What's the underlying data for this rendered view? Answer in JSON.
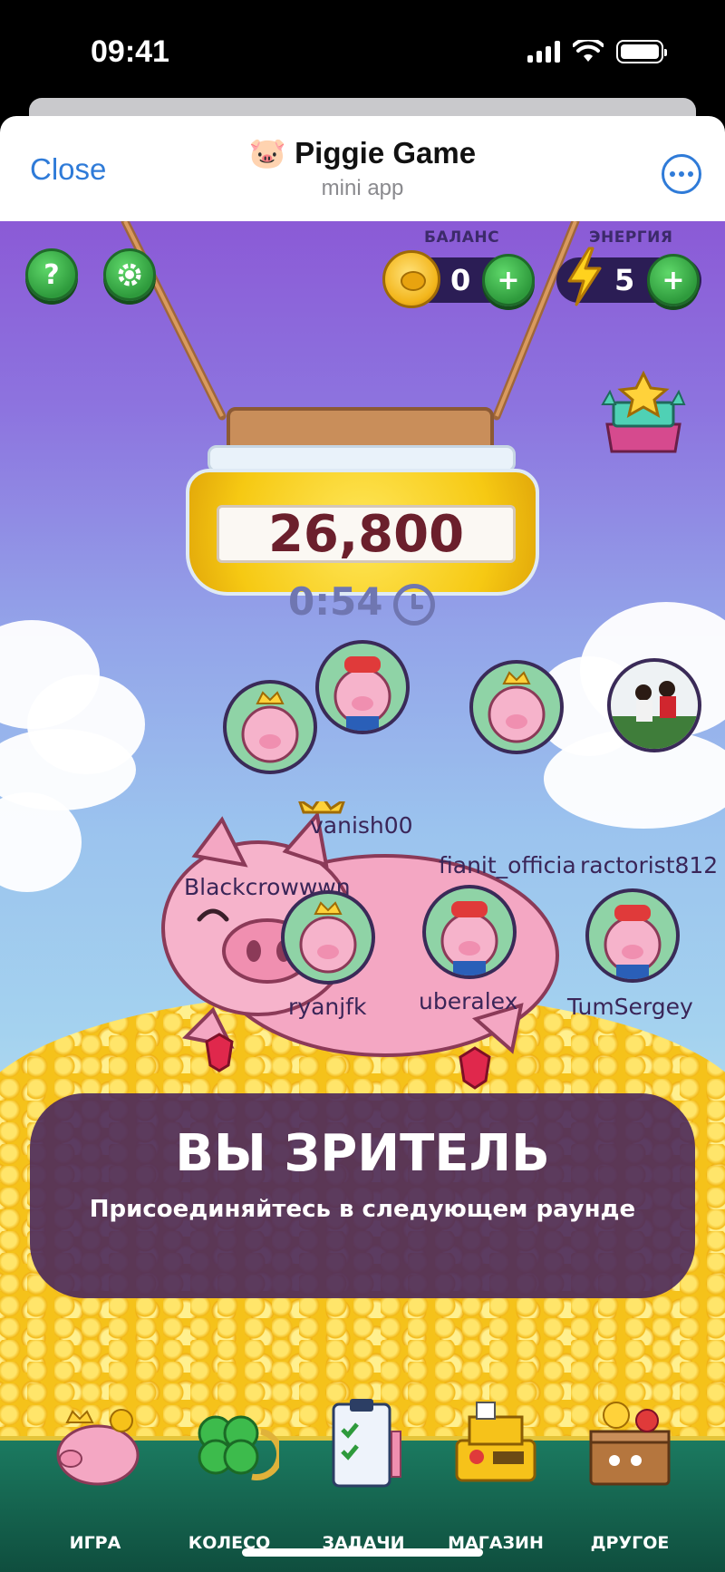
{
  "status": {
    "time": "09:41"
  },
  "header": {
    "close_label": "Close",
    "title": "🐷 Piggie Game",
    "subtitle": "mini app",
    "more_icon": "ellipsis-icon"
  },
  "hud": {
    "help_label": "?",
    "balance_label": "БАЛАНС",
    "balance_value": "0",
    "energy_label": "ЭНЕРГИЯ",
    "energy_value": "5",
    "plus_label": "+"
  },
  "jar": {
    "amount": "26,800"
  },
  "timer": "0:54",
  "players": [
    {
      "name": "vanish00",
      "avatar": "pig-cap"
    },
    {
      "name": "Blackcrowwwn",
      "avatar": "pig-crown-wave"
    },
    {
      "name": "fianit_officia",
      "avatar": "pig-crown"
    },
    {
      "name": "ractorist812",
      "avatar": "photo-football"
    },
    {
      "name": "ryanjfk",
      "avatar": "pig-crown"
    },
    {
      "name": "uberalex",
      "avatar": "pig-cap"
    },
    {
      "name": "TumSergey",
      "avatar": "pig-cap"
    }
  ],
  "overlay": {
    "title": "ВЫ ЗРИТЕЛЬ",
    "subtitle": "Присоединяйтесь в следующем раунде"
  },
  "nav": [
    {
      "label": "ИГРА",
      "icon": "piggy-bank-icon"
    },
    {
      "label": "КОЛЕСО",
      "icon": "clover-icon"
    },
    {
      "label": "ЗАДАЧИ",
      "icon": "clipboard-icon"
    },
    {
      "label": "МАГАЗИН",
      "icon": "cash-register-icon"
    },
    {
      "label": "ДРУГОЕ",
      "icon": "treasure-box-icon"
    }
  ],
  "colors": {
    "accent_blue": "#2f7bd8",
    "green_button": "#2e9a3c",
    "pill_bg": "#2b1d55",
    "overlay_bg": "#4a285c"
  }
}
